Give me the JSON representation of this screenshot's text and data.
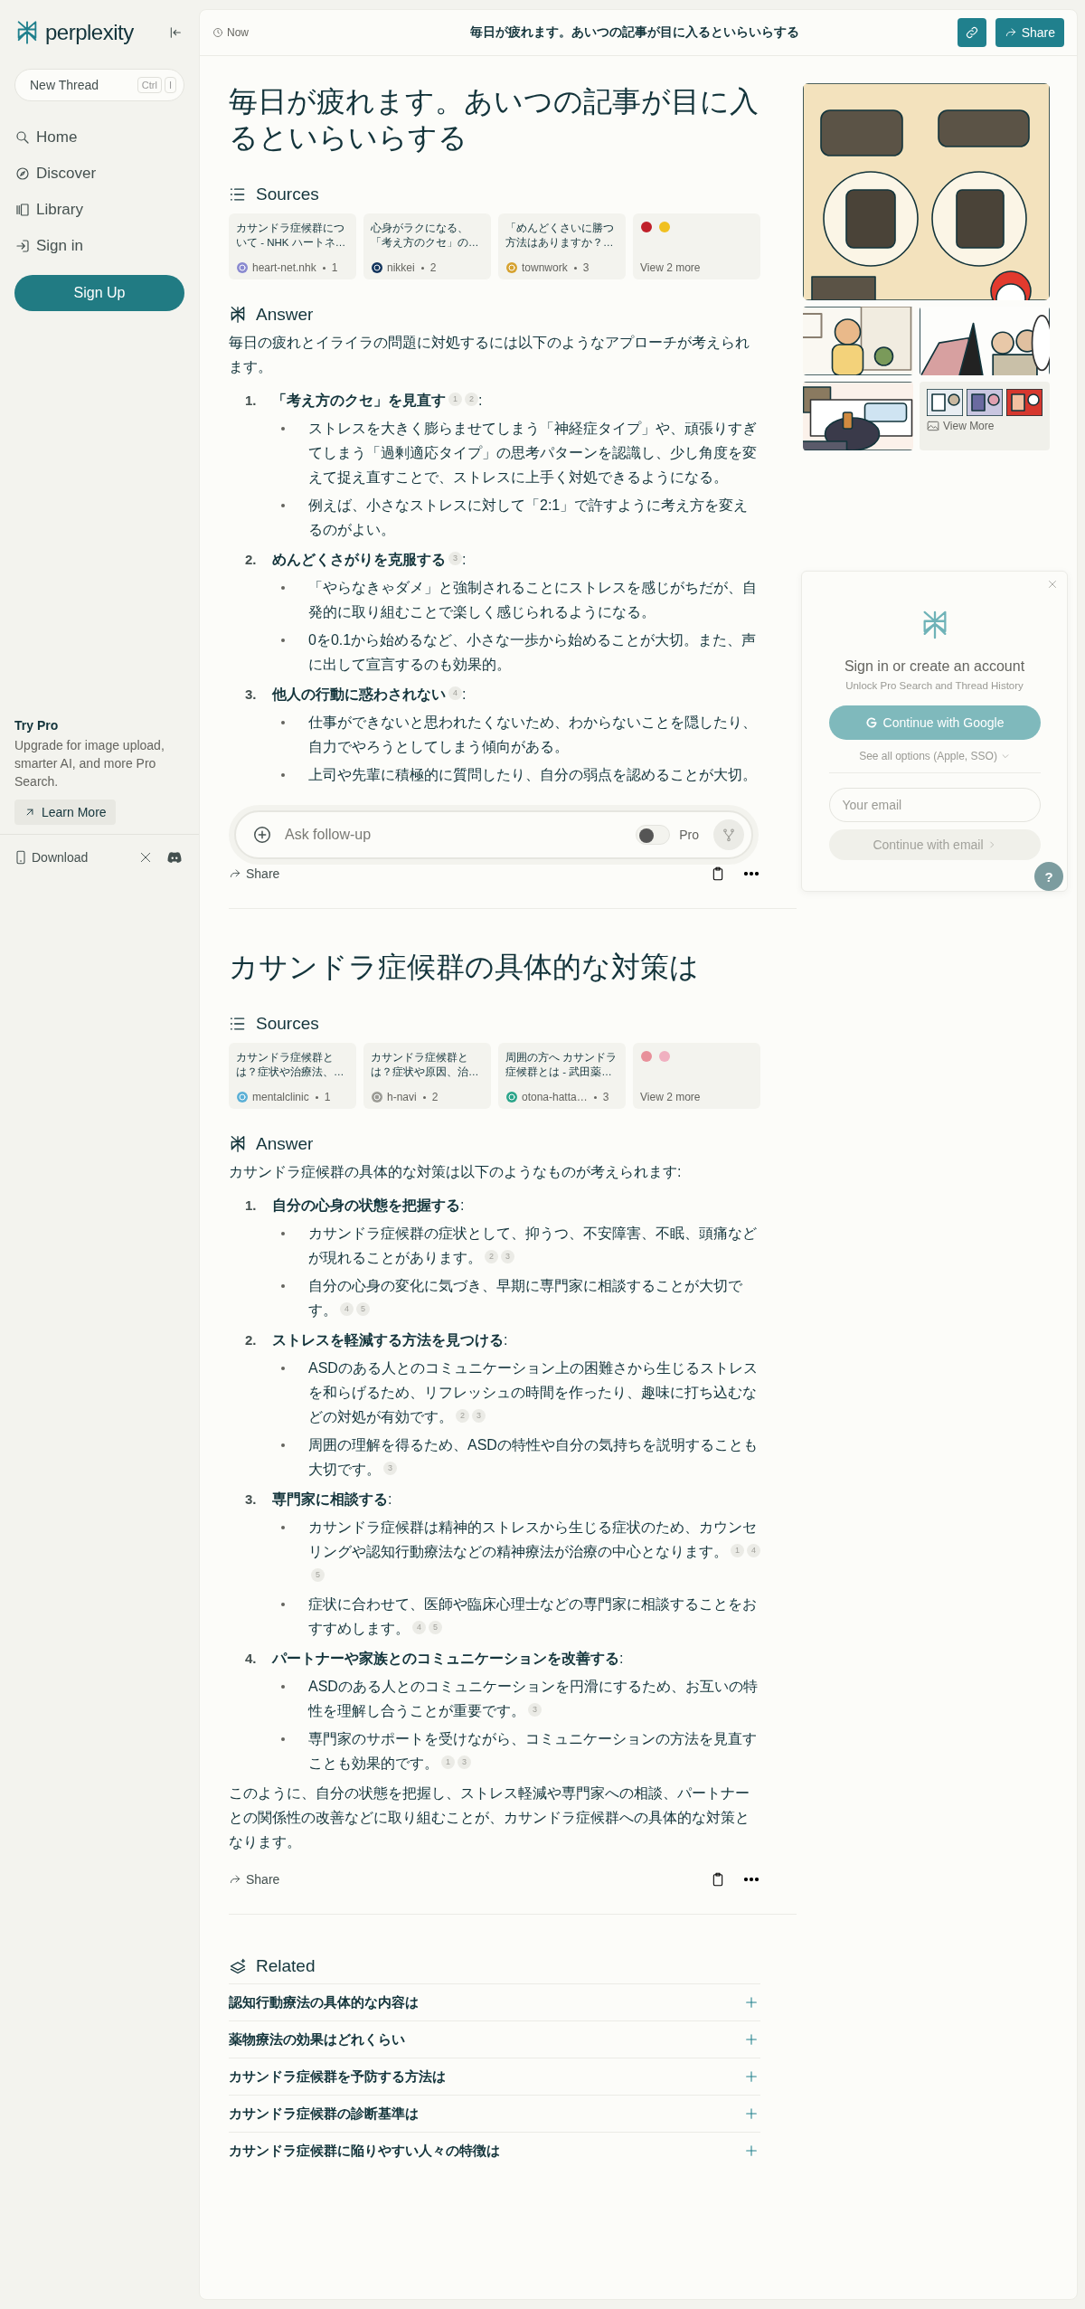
{
  "sidebar": {
    "brand": "perplexity",
    "new_thread": {
      "label": "New Thread",
      "keys": [
        "Ctrl",
        "I"
      ]
    },
    "nav": [
      {
        "label": "Home",
        "kind": "search"
      },
      {
        "label": "Discover",
        "kind": "compass"
      },
      {
        "label": "Library",
        "kind": "library"
      },
      {
        "label": "Sign in",
        "kind": "signin"
      }
    ],
    "signup": "Sign Up",
    "promo": {
      "title": "Try Pro",
      "text": "Upgrade for image upload, smarter AI, and more Pro Search.",
      "button": "Learn More"
    },
    "download": "Download"
  },
  "header": {
    "time": "Now",
    "title": "毎日が疲れます。あいつの記事が目に入るといらいらする",
    "share": "Share"
  },
  "threads": [
    {
      "question": "毎日が疲れます。あいつの記事が目に入るといらいらする",
      "sources_heading": "Sources",
      "sources": [
        {
          "title": "カサンドラ症候群について - NHK ハートネ…",
          "site": "heart-net.nhk",
          "index": "1"
        },
        {
          "title": "心身がラクになる、「考え方のクセ」の…",
          "site": "nikkei",
          "index": "2"
        },
        {
          "title": "「めんどくさいに勝つ方法はありますか？…",
          "site": "townwork",
          "index": "3"
        }
      ],
      "more": "View 2 more",
      "answer_heading": "Answer",
      "intro": "毎日の疲れとイライラの問題に対処するには以下のようなアプローチが考えられます。",
      "items": [
        {
          "number": "1.",
          "title": "「考え方のクセ」を見直す",
          "cites": [
            "1",
            "2"
          ],
          "suffix": ":",
          "bullets": [
            {
              "text": "ストレスを大きく膨らませてしまう「神経症タイプ」や、頑張りすぎてしまう「過剰適応タイプ」の思考パターンを認識し、少し角度を変えて捉え直すことで、ストレスに上手く対処できるようになる。"
            },
            {
              "text": "例えば、小さなストレスに対して「2:1」で許すように考え方を変えるのがよい。"
            }
          ]
        },
        {
          "number": "2.",
          "title": "めんどくさがりを克服する",
          "cites": [
            "3"
          ],
          "suffix": ":",
          "bullets": [
            {
              "text": "「やらなきゃダメ」と強制されることにストレスを感じがちだが、自発的に取り組むことで楽しく感じられるようになる。"
            },
            {
              "text": "0を0.1から始めるなど、小さな一歩から始めることが大切。また、声に出して宣言するのも効果的。"
            }
          ]
        },
        {
          "number": "3.",
          "title": "他人の行動に惑わされない",
          "cites": [
            "4"
          ],
          "suffix": ":",
          "bullets": [
            {
              "text": "仕事ができないと思われたくないため、わからないことを隠したり、自力でやろうとしてしまう傾向がある。"
            },
            {
              "text": "上司や先輩に積極的に質問したり、自分の弱点を認めることが大切。"
            }
          ]
        }
      ],
      "share": "Share"
    },
    {
      "question": "カサンドラ症候群の具体的な対策は",
      "sources_heading": "Sources",
      "sources": [
        {
          "title": "カサンドラ症候群とは？症状や治療法、…",
          "site": "mentalclinic",
          "index": "1"
        },
        {
          "title": "カサンドラ症候群とは？症状や原因、治…",
          "site": "h-navi",
          "index": "2"
        },
        {
          "title": "周囲の方へ カサンドラ症候群とは - 武田薬…",
          "site": "otona-hatta…",
          "index": "3"
        }
      ],
      "more": "View 2 more",
      "answer_heading": "Answer",
      "intro": "カサンドラ症候群の具体的な対策は以下のようなものが考えられます:",
      "items": [
        {
          "number": "1.",
          "title": "自分の心身の状態を把握する",
          "suffix": ":",
          "bullets": [
            {
              "text": "カサンドラ症候群の症状として、抑うつ、不安障害、不眠、頭痛などが現れることがあります。",
              "cites": [
                "2",
                "3"
              ]
            },
            {
              "text": "自分の心身の変化に気づき、早期に専門家に相談することが大切です。",
              "cites": [
                "4",
                "5"
              ]
            }
          ]
        },
        {
          "number": "2.",
          "title": "ストレスを軽減する方法を見つける",
          "suffix": ":",
          "bullets": [
            {
              "text": "ASDのある人とのコミュニケーション上の困難さから生じるストレスを和らげるため、リフレッシュの時間を作ったり、趣味に打ち込むなどの対処が有効です。",
              "cites": [
                "2",
                "3"
              ]
            },
            {
              "text": "周囲の理解を得るため、ASDの特性や自分の気持ちを説明することも大切です。",
              "cites": [
                "3"
              ]
            }
          ]
        },
        {
          "number": "3.",
          "title": "専門家に相談する",
          "suffix": ":",
          "bullets": [
            {
              "text": "カサンドラ症候群は精神的ストレスから生じる症状のため、カウンセリングや認知行動療法などの精神療法が治療の中心となります。",
              "cites": [
                "1",
                "4",
                "5"
              ]
            },
            {
              "text": "症状に合わせて、医師や臨床心理士などの専門家に相談することをおすすめします。",
              "cites": [
                "4",
                "5"
              ]
            }
          ]
        },
        {
          "number": "4.",
          "title": "パートナーや家族とのコミュニケーションを改善する",
          "suffix": ":",
          "bullets": [
            {
              "text": "ASDのある人とのコミュニケーションを円滑にするため、お互いの特性を理解し合うことが重要です。",
              "cites": [
                "3"
              ]
            },
            {
              "text": "専門家のサポートを受けながら、コミュニケーションの方法を見直すことも効果的です。",
              "cites": [
                "1",
                "3"
              ]
            }
          ]
        }
      ],
      "conclusion": "このように、自分の状態を把握し、ストレス軽減や専門家への相談、パートナーとの関係性の改善などに取り組むことが、カサンドラ症候群への具体的な対策となります。",
      "share": "Share"
    }
  ],
  "related": {
    "heading": "Related",
    "items": [
      "認知行動療法の具体的な内容は",
      "薬物療法の効果はどれくらい",
      "カサンドラ症候群を予防する方法は",
      "カサンドラ症候群の診断基準は",
      "カサンドラ症候群に陥りやすい人々の特徴は"
    ]
  },
  "images": {
    "view_more": "View More"
  },
  "followup": {
    "placeholder": "Ask follow-up",
    "pro": {
      "label": "Pro",
      "on": false
    }
  },
  "signin": {
    "title": "Sign in or create an account",
    "subtitle": "Unlock Pro Search and Thread History",
    "google": "Continue with Google",
    "options": "See all options (Apple, SSO)",
    "email_placeholder": "Your email",
    "email_button": {
      "label": "Continue with email",
      "disabled": true
    }
  },
  "help": "?"
}
